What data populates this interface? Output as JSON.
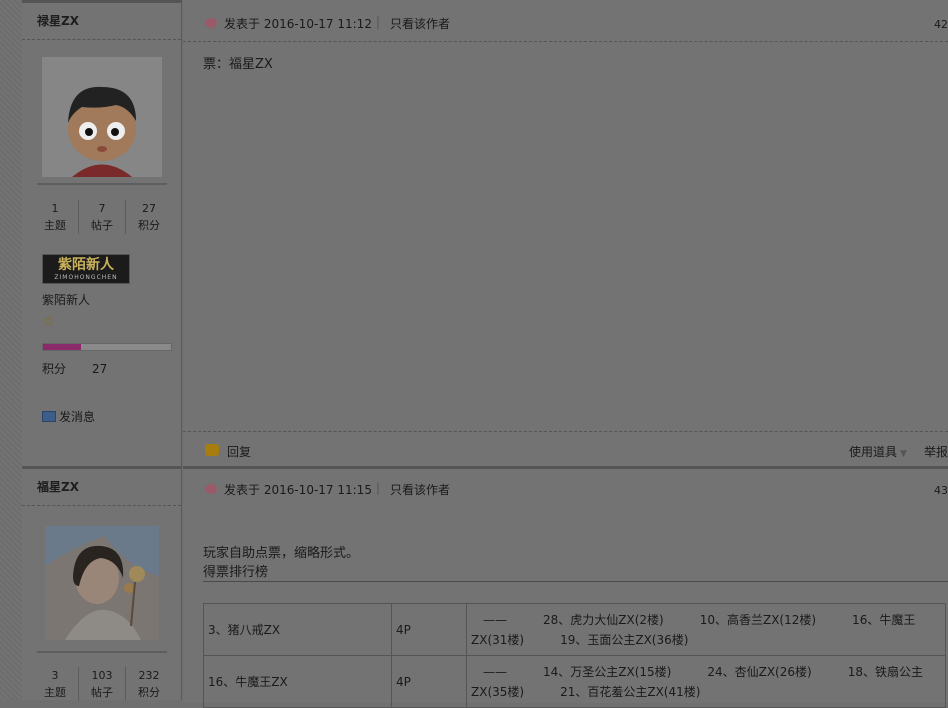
{
  "posts": [
    {
      "author": {
        "name": "禄星ZX",
        "avatar_desc_icon": "cartoon-boy-avatar",
        "stats": [
          {
            "value": "1",
            "label": "主题"
          },
          {
            "value": "7",
            "label": "帖子"
          },
          {
            "value": "27",
            "label": "积分"
          }
        ],
        "rank_badge": "紫陌新人",
        "rank_badge_sub": "ZIMOHONGCHEN",
        "rank_name": "紫陌新人",
        "progress": 0.3,
        "score_label": "积分",
        "score_value": "27",
        "send_message": "发消息"
      },
      "posted_at": "发表于 2016-10-17 11:12",
      "only_author": "只看该作者",
      "floor": "42",
      "content": "票：福星ZX",
      "footer": {
        "reply": "回复",
        "tools": "使用道具",
        "report": "举报"
      }
    },
    {
      "author": {
        "name": "福星ZX",
        "stats": [
          {
            "value": "3",
            "label": "主题"
          },
          {
            "value": "103",
            "label": "帖子"
          },
          {
            "value": "232",
            "label": "积分"
          }
        ]
      },
      "posted_at": "发表于 2016-10-17 11:15",
      "only_author": "只看该作者",
      "floor": "43",
      "content_line1": "玩家自助点票，缩略形式。",
      "content_line2": "得票排行榜",
      "table": [
        {
          "name": "3、猪八戒ZX",
          "votes": "4P",
          "detail": "　——　　　28、虎力大仙ZX(2楼)　　　10、高香兰ZX(12楼)　　　16、牛魔王ZX(31楼)　　　19、玉面公主ZX(36楼)"
        },
        {
          "name": "16、牛魔王ZX",
          "votes": "4P",
          "detail": "　——　　　14、万圣公主ZX(15楼)　　　24、杏仙ZX(26楼)　　　18、铁扇公主ZX(35楼)　　　21、百花羞公主ZX(41楼)"
        }
      ]
    }
  ]
}
